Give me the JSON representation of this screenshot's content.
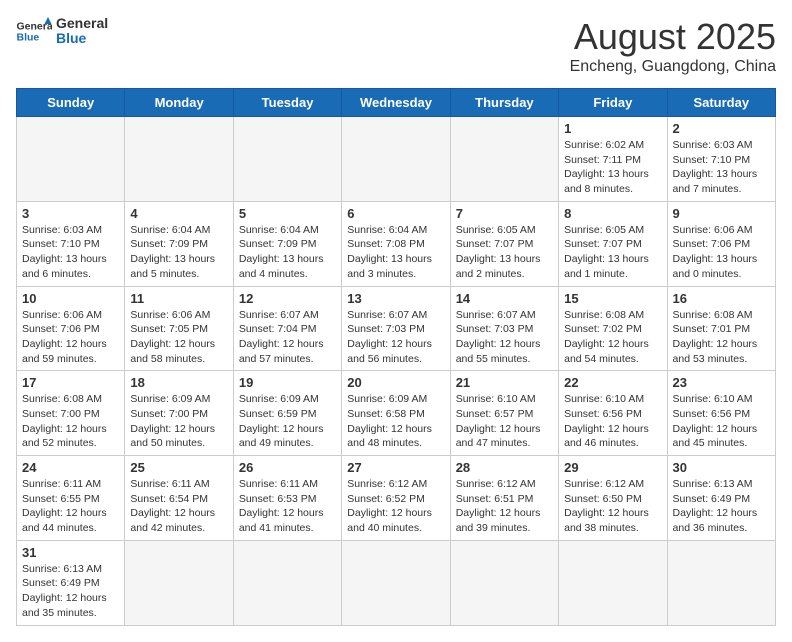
{
  "header": {
    "logo_general": "General",
    "logo_blue": "Blue",
    "month_title": "August 2025",
    "location": "Encheng, Guangdong, China"
  },
  "weekdays": [
    "Sunday",
    "Monday",
    "Tuesday",
    "Wednesday",
    "Thursday",
    "Friday",
    "Saturday"
  ],
  "weeks": [
    [
      {
        "day": "",
        "info": ""
      },
      {
        "day": "",
        "info": ""
      },
      {
        "day": "",
        "info": ""
      },
      {
        "day": "",
        "info": ""
      },
      {
        "day": "",
        "info": ""
      },
      {
        "day": "1",
        "info": "Sunrise: 6:02 AM\nSunset: 7:11 PM\nDaylight: 13 hours and 8 minutes."
      },
      {
        "day": "2",
        "info": "Sunrise: 6:03 AM\nSunset: 7:10 PM\nDaylight: 13 hours and 7 minutes."
      }
    ],
    [
      {
        "day": "3",
        "info": "Sunrise: 6:03 AM\nSunset: 7:10 PM\nDaylight: 13 hours and 6 minutes."
      },
      {
        "day": "4",
        "info": "Sunrise: 6:04 AM\nSunset: 7:09 PM\nDaylight: 13 hours and 5 minutes."
      },
      {
        "day": "5",
        "info": "Sunrise: 6:04 AM\nSunset: 7:09 PM\nDaylight: 13 hours and 4 minutes."
      },
      {
        "day": "6",
        "info": "Sunrise: 6:04 AM\nSunset: 7:08 PM\nDaylight: 13 hours and 3 minutes."
      },
      {
        "day": "7",
        "info": "Sunrise: 6:05 AM\nSunset: 7:07 PM\nDaylight: 13 hours and 2 minutes."
      },
      {
        "day": "8",
        "info": "Sunrise: 6:05 AM\nSunset: 7:07 PM\nDaylight: 13 hours and 1 minute."
      },
      {
        "day": "9",
        "info": "Sunrise: 6:06 AM\nSunset: 7:06 PM\nDaylight: 13 hours and 0 minutes."
      }
    ],
    [
      {
        "day": "10",
        "info": "Sunrise: 6:06 AM\nSunset: 7:06 PM\nDaylight: 12 hours and 59 minutes."
      },
      {
        "day": "11",
        "info": "Sunrise: 6:06 AM\nSunset: 7:05 PM\nDaylight: 12 hours and 58 minutes."
      },
      {
        "day": "12",
        "info": "Sunrise: 6:07 AM\nSunset: 7:04 PM\nDaylight: 12 hours and 57 minutes."
      },
      {
        "day": "13",
        "info": "Sunrise: 6:07 AM\nSunset: 7:03 PM\nDaylight: 12 hours and 56 minutes."
      },
      {
        "day": "14",
        "info": "Sunrise: 6:07 AM\nSunset: 7:03 PM\nDaylight: 12 hours and 55 minutes."
      },
      {
        "day": "15",
        "info": "Sunrise: 6:08 AM\nSunset: 7:02 PM\nDaylight: 12 hours and 54 minutes."
      },
      {
        "day": "16",
        "info": "Sunrise: 6:08 AM\nSunset: 7:01 PM\nDaylight: 12 hours and 53 minutes."
      }
    ],
    [
      {
        "day": "17",
        "info": "Sunrise: 6:08 AM\nSunset: 7:00 PM\nDaylight: 12 hours and 52 minutes."
      },
      {
        "day": "18",
        "info": "Sunrise: 6:09 AM\nSunset: 7:00 PM\nDaylight: 12 hours and 50 minutes."
      },
      {
        "day": "19",
        "info": "Sunrise: 6:09 AM\nSunset: 6:59 PM\nDaylight: 12 hours and 49 minutes."
      },
      {
        "day": "20",
        "info": "Sunrise: 6:09 AM\nSunset: 6:58 PM\nDaylight: 12 hours and 48 minutes."
      },
      {
        "day": "21",
        "info": "Sunrise: 6:10 AM\nSunset: 6:57 PM\nDaylight: 12 hours and 47 minutes."
      },
      {
        "day": "22",
        "info": "Sunrise: 6:10 AM\nSunset: 6:56 PM\nDaylight: 12 hours and 46 minutes."
      },
      {
        "day": "23",
        "info": "Sunrise: 6:10 AM\nSunset: 6:56 PM\nDaylight: 12 hours and 45 minutes."
      }
    ],
    [
      {
        "day": "24",
        "info": "Sunrise: 6:11 AM\nSunset: 6:55 PM\nDaylight: 12 hours and 44 minutes."
      },
      {
        "day": "25",
        "info": "Sunrise: 6:11 AM\nSunset: 6:54 PM\nDaylight: 12 hours and 42 minutes."
      },
      {
        "day": "26",
        "info": "Sunrise: 6:11 AM\nSunset: 6:53 PM\nDaylight: 12 hours and 41 minutes."
      },
      {
        "day": "27",
        "info": "Sunrise: 6:12 AM\nSunset: 6:52 PM\nDaylight: 12 hours and 40 minutes."
      },
      {
        "day": "28",
        "info": "Sunrise: 6:12 AM\nSunset: 6:51 PM\nDaylight: 12 hours and 39 minutes."
      },
      {
        "day": "29",
        "info": "Sunrise: 6:12 AM\nSunset: 6:50 PM\nDaylight: 12 hours and 38 minutes."
      },
      {
        "day": "30",
        "info": "Sunrise: 6:13 AM\nSunset: 6:49 PM\nDaylight: 12 hours and 36 minutes."
      }
    ],
    [
      {
        "day": "31",
        "info": "Sunrise: 6:13 AM\nSunset: 6:49 PM\nDaylight: 12 hours and 35 minutes."
      },
      {
        "day": "",
        "info": ""
      },
      {
        "day": "",
        "info": ""
      },
      {
        "day": "",
        "info": ""
      },
      {
        "day": "",
        "info": ""
      },
      {
        "day": "",
        "info": ""
      },
      {
        "day": "",
        "info": ""
      }
    ]
  ]
}
